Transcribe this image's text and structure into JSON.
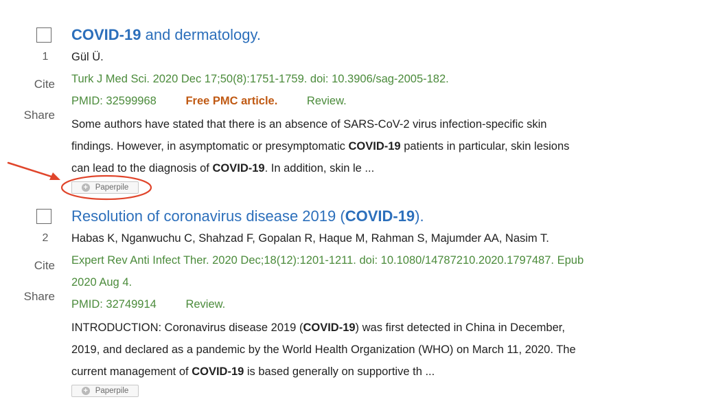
{
  "results": [
    {
      "index": "1",
      "cite_label": "Cite",
      "share_label": "Share",
      "title_bold": "COVID-19",
      "title_rest": " and dermatology.",
      "authors": "Gül Ü.",
      "citation_line1": "Turk J Med Sci. 2020 Dec 17;50(8):1751-1759. doi: 10.3906/sag-2005-182.",
      "pmid": "PMID: 32599968",
      "free_pmc": "Free PMC article.",
      "review": "Review.",
      "snippet": [
        {
          "t": "Some authors have stated that there is an absence of SARS-CoV-2 virus infection-specific skin"
        },
        {
          "t": "findings. However, in asymptomatic or presymptomatic ",
          "b": "COVID-19",
          "r": " patients in particular, skin lesions"
        },
        {
          "t": "can lead to the diagnosis of ",
          "b": "COVID-19",
          "r": ". In addition, skin le ..."
        }
      ],
      "paperpile_label": "Paperpile"
    },
    {
      "index": "2",
      "cite_label": "Cite",
      "share_label": "Share",
      "title_pre": "Resolution of coronavirus disease 2019 (",
      "title_bold": "COVID-19",
      "title_post": ").",
      "authors": "Habas K, Nganwuchu C, Shahzad F, Gopalan R, Haque M, Rahman S, Majumder AA, Nasim T.",
      "citation_line1": "Expert Rev Anti Infect Ther. 2020 Dec;18(12):1201-1211. doi: 10.1080/14787210.2020.1797487. Epub",
      "citation_line2": "2020 Aug 4.",
      "pmid": "PMID: 32749914",
      "review": "Review.",
      "snippet": [
        {
          "t": "INTRODUCTION: Coronavirus disease 2019 (",
          "b": "COVID-19",
          "r": ") was first detected in China in December,"
        },
        {
          "t": "2019, and declared as a pandemic by the World Health Organization (WHO) on March 11, 2020. The"
        },
        {
          "t": "current management of ",
          "b": "COVID-19",
          "r": " is based generally on supportive th ..."
        }
      ],
      "paperpile_label": "Paperpile"
    }
  ],
  "annotation_color": "#e0452b",
  "icons": {
    "paperpile": "plus-circle-icon",
    "annotation": "arrow-icon"
  }
}
